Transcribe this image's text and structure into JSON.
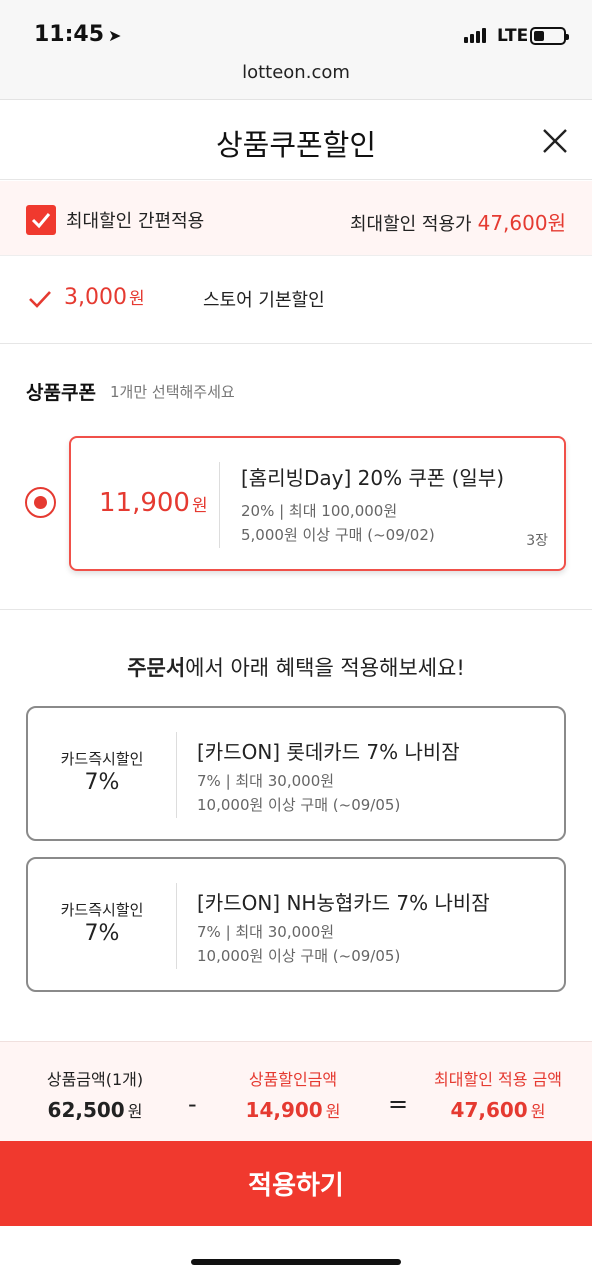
{
  "status_bar": {
    "time": "11:45",
    "network": "LTE"
  },
  "browser": {
    "url": "lotteon.com"
  },
  "header": {
    "title": "상품쿠폰할인"
  },
  "max_discount": {
    "label": "최대할인 간편적용",
    "price_label": "최대할인 적용가",
    "price": "47,600원",
    "checked": true
  },
  "store_discount": {
    "amount": "3,000",
    "currency": "원",
    "label": "스토어 기본할인"
  },
  "product_coupon": {
    "title": "상품쿠폰",
    "hint": "1개만 선택해주세요",
    "coupons": [
      {
        "amount": "11,900",
        "currency": "원",
        "name": "[홈리빙Day] 20% 쿠폰 (일부)",
        "detail1": "20% | 최대 100,000원",
        "detail2": "5,000원 이상 구매 (~09/02)",
        "count": "3장",
        "selected": true
      }
    ]
  },
  "order_benefits": {
    "title_bold": "주문서",
    "title_rest": "에서 아래 혜택을 적용해보세요!",
    "cards": [
      {
        "kind": "카드즉시할인",
        "percent": "7%",
        "name": "[카드ON] 롯데카드 7% 나비잠",
        "detail1": "7% | 최대 30,000원",
        "detail2": "10,000원 이상 구매 (~09/05)"
      },
      {
        "kind": "카드즉시할인",
        "percent": "7%",
        "name": "[카드ON] NH농협카드 7% 나비잠",
        "detail1": "7% | 최대 30,000원",
        "detail2": "10,000원 이상 구매 (~09/05)"
      }
    ]
  },
  "summary": {
    "product_label": "상품금액(1개)",
    "product_amount": "62,500",
    "minus": "-",
    "discount_label": "상품할인금액",
    "discount_amount": "14,900",
    "equals": "=",
    "final_label": "최대할인 적용 금액",
    "final_amount": "47,600",
    "currency": "원"
  },
  "apply_button": {
    "label": "적용하기"
  },
  "colors": {
    "accent": "#f0392e",
    "accent_text": "#e53a31",
    "bg_tint": "#fff5f4"
  }
}
